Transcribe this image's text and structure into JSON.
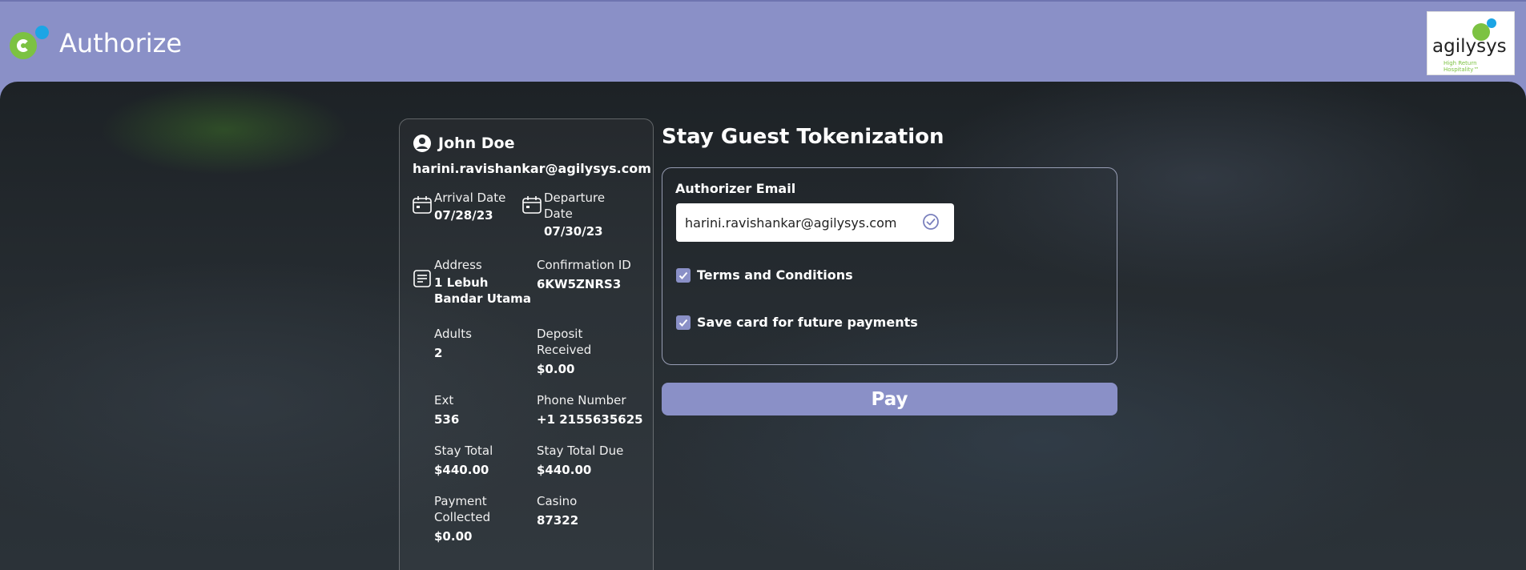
{
  "header": {
    "title": "Authorize",
    "brand_icon": "authorize-logo-icon",
    "partner_logo": {
      "word": "agilysys",
      "tagline": "High Return Hospitality™"
    }
  },
  "colors": {
    "header_bg": "#8a90c7",
    "accent": "#8a90c7",
    "brand_green": "#7cc242",
    "brand_blue": "#1ba5e5"
  },
  "guest": {
    "name": "John Doe",
    "email": "harini.ravishankar@agilysys.com",
    "arrival": {
      "label": "Arrival Date",
      "value": "07/28/23",
      "icon": "calendar-icon"
    },
    "departure": {
      "label": "Departure Date",
      "value": "07/30/23",
      "icon": "calendar-icon"
    },
    "address": {
      "label": "Address",
      "value": "1 Lebuh Bandar Utama",
      "icon": "address-icon"
    },
    "confirmation": {
      "label": "Confirmation ID",
      "value": "6KW5ZNRS3"
    },
    "adults": {
      "label": "Adults",
      "value": "2"
    },
    "deposit": {
      "label": "Deposit Received",
      "value": "$0.00"
    },
    "ext": {
      "label": "Ext",
      "value": "536"
    },
    "phone": {
      "label": "Phone Number",
      "value": "+1 2155635625"
    },
    "stay_total": {
      "label": "Stay Total",
      "value": "$440.00"
    },
    "stay_total_due": {
      "label": "Stay Total Due",
      "value": "$440.00"
    },
    "payment_collected": {
      "label": "Payment Collected",
      "value": "$0.00"
    },
    "casino": {
      "label": "Casino",
      "value": "87322"
    }
  },
  "form": {
    "title": "Stay Guest Tokenization",
    "email_label": "Authorizer Email",
    "email_value": "harini.ravishankar@agilysys.com",
    "terms_label": "Terms and Conditions",
    "terms_checked": true,
    "save_card_label": "Save card for future payments",
    "save_card_checked": true,
    "pay_label": "Pay"
  }
}
